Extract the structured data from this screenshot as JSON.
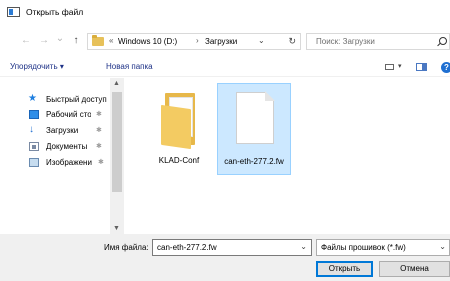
{
  "window": {
    "title": "Открыть файл"
  },
  "navigation": {
    "back": "←",
    "forward": "→",
    "recent": "⌄",
    "up": "↑",
    "path_overflow": "«",
    "path_sep": "›",
    "path": [
      "Windows 10 (D:)",
      "Загрузки"
    ],
    "address_dropdown": "⌄",
    "refresh": "↻"
  },
  "search": {
    "placeholder": "Поиск: Загрузки"
  },
  "toolbar": {
    "organize_label": "Упорядочить ▾",
    "new_folder_label": "Новая папка",
    "view_dropdown": "▾",
    "help": "?"
  },
  "sidebar": {
    "items": [
      {
        "label": "Быстрый доступ",
        "icon": "star-icon",
        "pinned": false
      },
      {
        "label": "Рабочий сто",
        "icon": "desktop-icon",
        "pinned": true
      },
      {
        "label": "Загрузки",
        "icon": "downloads-icon",
        "pinned": true
      },
      {
        "label": "Документы",
        "icon": "documents-icon",
        "pinned": true
      },
      {
        "label": "Изображени",
        "icon": "images-icon",
        "pinned": true
      }
    ],
    "pin_glyph": "✱",
    "scroll_up": "▲",
    "scroll_down": "▼"
  },
  "files": [
    {
      "name": "KLAD-Conf",
      "kind": "folder",
      "selected": false
    },
    {
      "name": "can-eth-277.2.fw",
      "kind": "file",
      "selected": true
    }
  ],
  "footer": {
    "filename_label": "Имя файла:",
    "filename_value": "can-eth-277.2.fw",
    "filename_dropdown": "⌄",
    "filetype_value": "Файлы прошивок (*.fw)",
    "filetype_dropdown": "⌄",
    "open_label": "Открыть",
    "cancel_label": "Отмена"
  },
  "colors": {
    "accent": "#0078d7",
    "selection_fill": "#cce8ff",
    "selection_border": "#99d1ff",
    "link_text": "#1e3287",
    "footer_bg": "#f0f0f0"
  }
}
